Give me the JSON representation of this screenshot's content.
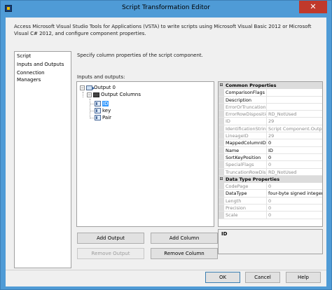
{
  "window": {
    "title": "Script Transformation Editor",
    "close_glyph": "✕"
  },
  "intro": "Access Microsoft Visual Studio Tools for Applications (VSTA) to write scripts using Microsoft Visual Basic 2012 or Microsoft Visual C# 2012, and configure component properties.",
  "nav": {
    "items": [
      {
        "label": "Script"
      },
      {
        "label": "Inputs and Outputs"
      },
      {
        "label": "Connection Managers"
      }
    ],
    "selected": "Inputs and Outputs"
  },
  "section_description": "Specify column properties of the script component.",
  "io_label": "Inputs and outputs:",
  "tree": {
    "output": "Output 0",
    "output_columns": "Output Columns",
    "columns": [
      "ID",
      "key",
      "Pair"
    ],
    "selected_column": "ID"
  },
  "properties": {
    "categories": [
      {
        "name": "Common Properties",
        "rows": [
          {
            "name": "ComparisonFlags",
            "value": "",
            "readonly": false
          },
          {
            "name": "Description",
            "value": "",
            "readonly": false
          },
          {
            "name": "ErrorOrTruncation(",
            "value": "",
            "readonly": true
          },
          {
            "name": "ErrorRowDispositio",
            "value": "RD_NotUsed",
            "readonly": true
          },
          {
            "name": "ID",
            "value": "29",
            "readonly": true
          },
          {
            "name": "IdentificationString",
            "value": "Script Component.Outputs",
            "readonly": true
          },
          {
            "name": "LineageID",
            "value": "29",
            "readonly": true
          },
          {
            "name": "MappedColumnID",
            "value": "0",
            "readonly": false
          },
          {
            "name": "Name",
            "value": "ID",
            "readonly": false
          },
          {
            "name": "SortKeyPosition",
            "value": "0",
            "readonly": false
          },
          {
            "name": "SpecialFlags",
            "value": "0",
            "readonly": true
          },
          {
            "name": "TruncationRowDisp",
            "value": "RD_NotUsed",
            "readonly": true
          }
        ]
      },
      {
        "name": "Data Type Properties",
        "rows": [
          {
            "name": "CodePage",
            "value": "0",
            "readonly": true
          },
          {
            "name": "DataType",
            "value": "four-byte signed integer [D",
            "readonly": false
          },
          {
            "name": "Length",
            "value": "0",
            "readonly": true
          },
          {
            "name": "Precision",
            "value": "0",
            "readonly": true
          },
          {
            "name": "Scale",
            "value": "0",
            "readonly": true
          }
        ]
      }
    ],
    "description_title": "ID"
  },
  "buttons": {
    "add_output": "Add Output",
    "add_column": "Add Column",
    "remove_output": "Remove Output",
    "remove_column": "Remove Column",
    "ok": "OK",
    "cancel": "Cancel",
    "help": "Help"
  }
}
